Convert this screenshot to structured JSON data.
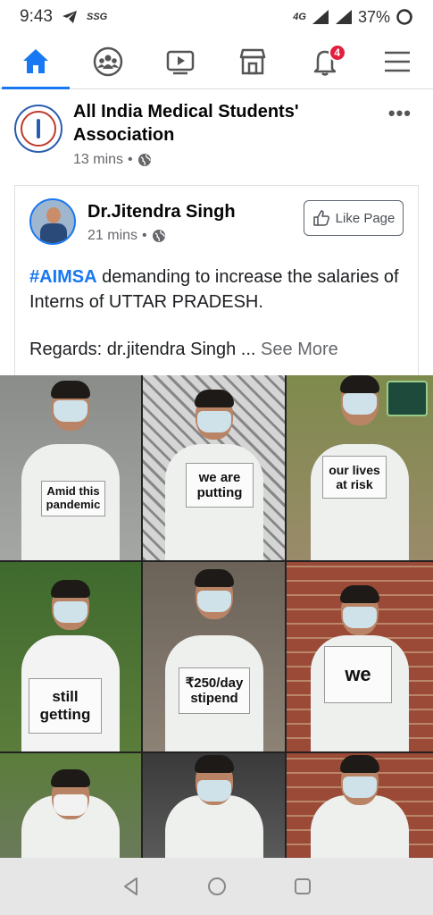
{
  "status_bar": {
    "time": "9:43",
    "carrier_mark": "SSG",
    "network": "4G",
    "battery": "37%"
  },
  "nav": {
    "items": [
      {
        "name": "home",
        "icon": "home-icon",
        "active": true
      },
      {
        "name": "groups",
        "icon": "groups-icon"
      },
      {
        "name": "watch",
        "icon": "video-icon"
      },
      {
        "name": "marketplace",
        "icon": "store-icon"
      },
      {
        "name": "notifications",
        "icon": "bell-icon",
        "badge": "4"
      },
      {
        "name": "menu",
        "icon": "hamburger-icon"
      }
    ]
  },
  "post": {
    "author": "All India Medical Students' Association",
    "time": "13 mins",
    "more": "•••"
  },
  "shared": {
    "author": "Dr.Jitendra Singh",
    "time": "21 mins",
    "like_page": "Like Page",
    "hashtag": "#AIMSA",
    "text": " demanding to increase the salaries of Interns of UTTAR PRADESH.",
    "regards": "Regards: dr.jitendra Singh ...",
    "see_more": "See More"
  },
  "photos": {
    "signs": [
      "Amid this pandemic",
      "we are putting",
      "our lives at risk",
      "still getting",
      "₹250/day stipend",
      "we"
    ]
  },
  "colors": {
    "accent": "#1877f2",
    "badge": "#e41e3f"
  }
}
